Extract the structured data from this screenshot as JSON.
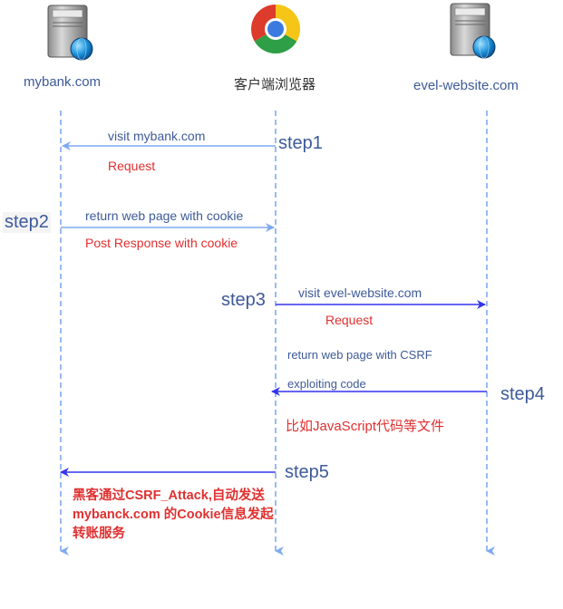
{
  "actors": {
    "bank": "mybank.com",
    "browser": "客户端浏览器",
    "evil": "evel-website.com"
  },
  "icons": {
    "bank": "server-globe-icon",
    "browser": "chrome-browser-icon",
    "evil": "server-globe-icon"
  },
  "messages": {
    "m1_label": "visit mybank.com",
    "m1_sub": "Request",
    "m2_label": "return web page with cookie",
    "m2_sub": "Post Response with cookie",
    "m3_label": "visit evel-website.com",
    "m3_sub": "Request",
    "m4_label_1": "return web page with CSRF",
    "m4_label_2": "exploiting code",
    "m4_sub": "比如JavaScript代码等文件",
    "m5_note": "黑客通过CSRF_Attack,自动发送 mybanck.com 的Cookie信息发起转账服务"
  },
  "steps": {
    "s1": "step1",
    "s2": "step2",
    "s3": "step3",
    "s4": "step4",
    "s5": "step5"
  },
  "colors": {
    "lifeline": "#7eaaf0",
    "arrow_light": "#7eaaf0",
    "arrow_dark": "#3333ee",
    "text_blue": "#3d5a99",
    "text_red": "#e03030"
  }
}
